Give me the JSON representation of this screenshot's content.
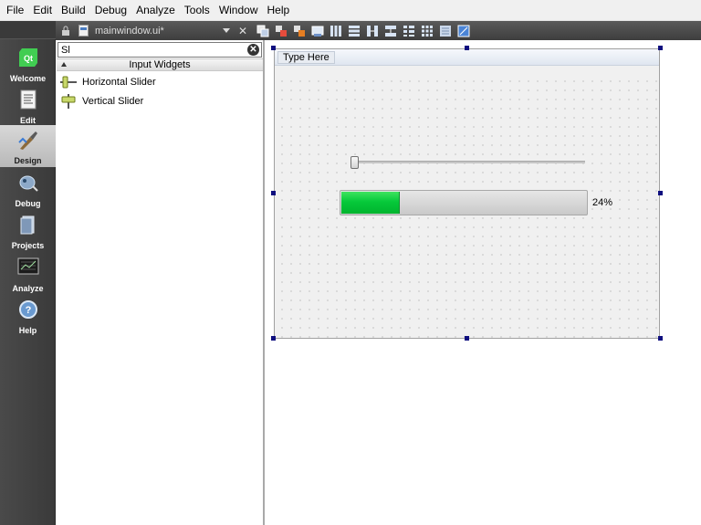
{
  "menu": [
    "File",
    "Edit",
    "Build",
    "Debug",
    "Analyze",
    "Tools",
    "Window",
    "Help"
  ],
  "modes": [
    {
      "label": "Welcome",
      "icon": "qt-logo-icon"
    },
    {
      "label": "Edit",
      "icon": "edit-document-icon"
    },
    {
      "label": "Design",
      "icon": "design-brush-icon",
      "active": true
    },
    {
      "label": "Debug",
      "icon": "debug-bug-icon"
    },
    {
      "label": "Projects",
      "icon": "projects-folder-icon"
    },
    {
      "label": "Analyze",
      "icon": "analyze-monitor-icon"
    },
    {
      "label": "Help",
      "icon": "help-question-icon"
    }
  ],
  "editor": {
    "file_name": "mainwindow.ui*",
    "close_glyph": "✕"
  },
  "widget_box": {
    "filter_value": "Sl",
    "clear_glyph": "✕",
    "category": "Input Widgets",
    "items": [
      "Horizontal Slider",
      "Vertical Slider"
    ]
  },
  "form": {
    "menubar_placeholder": "Type Here",
    "slider_value_fraction": 0.0,
    "progress_value": 24,
    "progress_text": "24%"
  },
  "colors": {
    "accent_green": "#06c93a",
    "selection_handle": "#0f0f7f"
  }
}
